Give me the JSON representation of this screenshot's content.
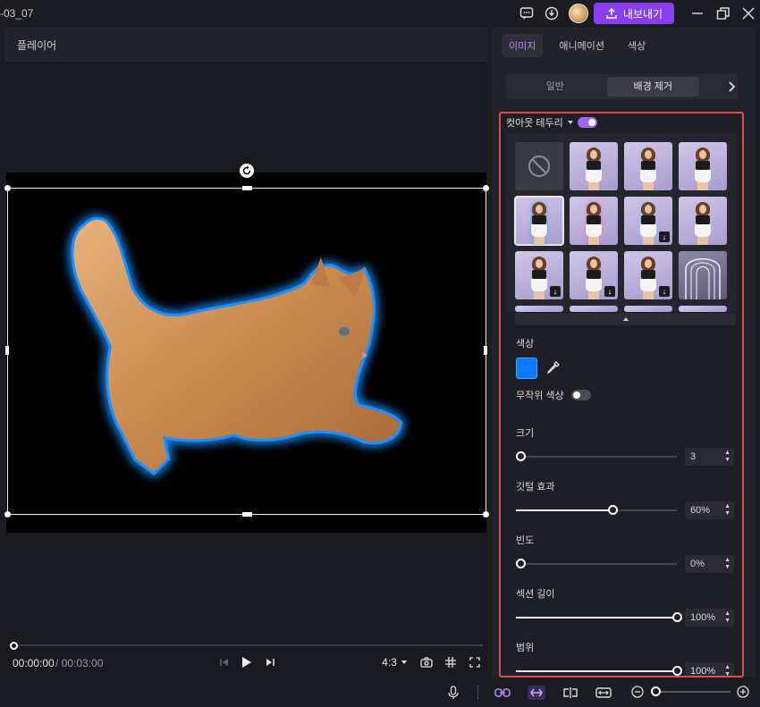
{
  "window": {
    "title": "-03_07",
    "export_label": "내보내기"
  },
  "player": {
    "title": "플레이어",
    "time_current": "00:00:00",
    "time_separator": "/",
    "time_total": "00:03:00",
    "aspect_ratio": "4:3",
    "progress": 0
  },
  "panel": {
    "tabs": [
      {
        "label": "이미지",
        "active": true
      },
      {
        "label": "애니메이션",
        "active": false
      },
      {
        "label": "색상",
        "active": false
      }
    ],
    "subtabs": [
      {
        "label": "일반",
        "active": false
      },
      {
        "label": "배경 제거",
        "active": true
      }
    ],
    "cutout": {
      "label": "컷아웃 테두리",
      "enabled": true
    },
    "color": {
      "label": "색상",
      "value": "#0d7bff"
    },
    "random_color": {
      "label": "무작위 색상",
      "enabled": false
    },
    "size": {
      "label": "크기",
      "value": "3",
      "fraction": 0.02
    },
    "feather": {
      "label": "깃털 효과",
      "value": "60%",
      "fraction": 0.6
    },
    "frequency": {
      "label": "빈도",
      "value": "0%",
      "fraction": 0.0
    },
    "section_length": {
      "label": "섹션 길이",
      "value": "100%",
      "fraction": 1.0
    },
    "range": {
      "label": "범위",
      "value": "100%",
      "fraction": 1.0
    }
  },
  "colors": {
    "accent": "#8a3df2",
    "tab_active": "#b98bff",
    "highlight_frame": "#e34a4a",
    "glow": "#1e90ff"
  }
}
